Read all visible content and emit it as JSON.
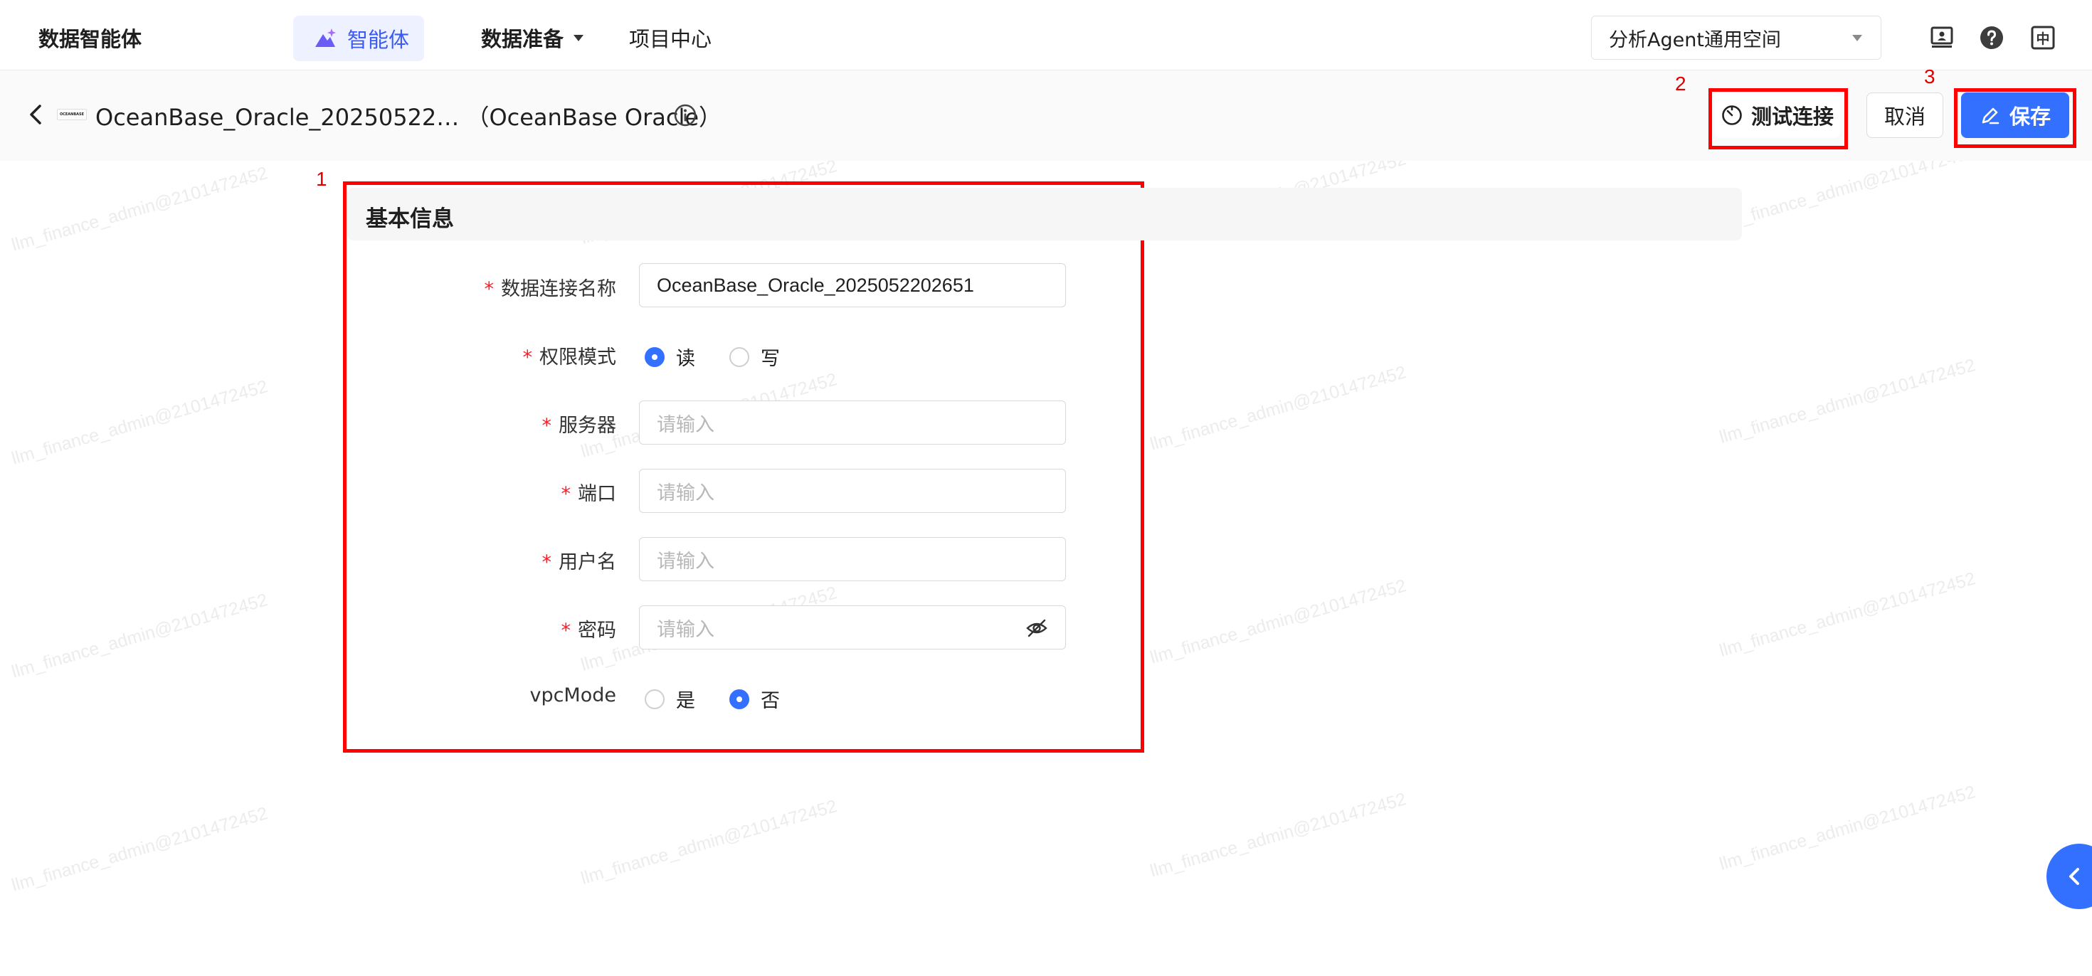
{
  "app": {
    "brand": "数据智能体",
    "nav": {
      "agent_label": "智能体",
      "data_prep_label": "数据准备",
      "project_center_label": "项目中心"
    },
    "workspace": {
      "selected": "分析Agent通用空间"
    },
    "toolbar_icons": [
      "screen-share-icon",
      "help-icon",
      "language-zh-icon"
    ],
    "language_glyph": "中"
  },
  "header": {
    "logo_text": "OCEANBASE",
    "title": "OceanBase_Oracle_20250522…  （OceanBase Oracle）",
    "test_connection_label": "测试连接",
    "cancel_label": "取消",
    "save_label": "保存"
  },
  "annotations": [
    "1",
    "2",
    "3"
  ],
  "form": {
    "section_title": "基本信息",
    "required_mark": "*",
    "fields": {
      "connection_name": {
        "label": "数据连接名称",
        "value": "OceanBase_Oracle_2025052202651"
      },
      "permission_mode": {
        "label": "权限模式",
        "options": [
          "读",
          "写"
        ],
        "selected": "读"
      },
      "server": {
        "label": "服务器",
        "placeholder": "请输入"
      },
      "port": {
        "label": "端口",
        "placeholder": "请输入"
      },
      "username": {
        "label": "用户名",
        "placeholder": "请输入"
      },
      "password": {
        "label": "密码",
        "placeholder": "请输入"
      },
      "vpc_mode": {
        "label": "vpcMode",
        "options": [
          "是",
          "否"
        ],
        "selected": "否"
      }
    }
  },
  "watermark": {
    "text": "llm_finance_admin@2101472452"
  },
  "colors": {
    "primary": "#3370ff",
    "required": "#f5222d",
    "annotation": "#ff0000",
    "nav_active_bg": "#eef1ff"
  }
}
